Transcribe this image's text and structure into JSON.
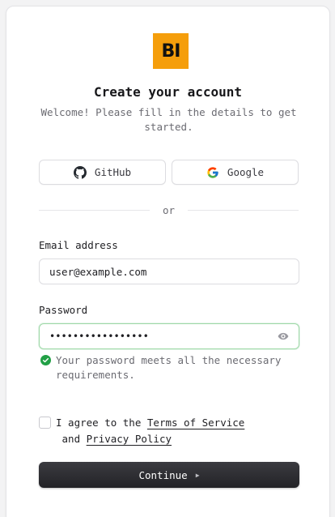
{
  "brand": {
    "logo_text": "BI",
    "color": "#f59e0b"
  },
  "header": {
    "title": "Create your account",
    "subtitle": "Welcome! Please fill in the details to get started."
  },
  "social": {
    "github_label": "GitHub",
    "google_label": "Google"
  },
  "divider_text": "or",
  "form": {
    "email_label": "Email address",
    "email_value": "user@example.com",
    "password_label": "Password",
    "password_value_masked": "•••••••••••••••••",
    "password_hint": "Your password meets all the necessary requirements.",
    "password_hint_color": "#22a046"
  },
  "consent": {
    "prefix": "I agree to the ",
    "terms_link": "Terms of Service",
    "middle": " and ",
    "privacy_link": "Privacy Policy",
    "checked": false
  },
  "actions": {
    "continue_label": "Continue",
    "continue_icon": "caret-right-icon"
  },
  "icons": {
    "github": "github-icon",
    "google": "google-icon",
    "password_toggle": "eye-icon",
    "valid": "check-circle-icon"
  }
}
